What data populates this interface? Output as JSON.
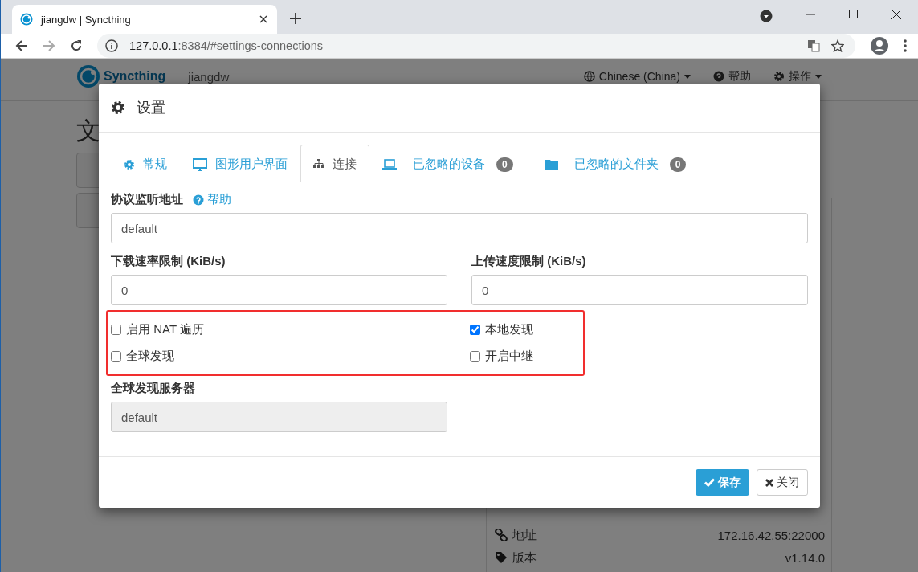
{
  "browser": {
    "tab_title": "jiangdw | Syncthing",
    "url_host": "127.0.0.1",
    "url_rest": ":8384/#settings-connections"
  },
  "page": {
    "brand": "Syncthing",
    "device_name": "jiangdw",
    "nav": [
      {
        "kind": "language",
        "label": "Chinese (China)"
      },
      {
        "kind": "help",
        "label": "帮助"
      },
      {
        "kind": "actions",
        "label": "操作"
      }
    ],
    "heading": "文",
    "info_rows": [
      {
        "kind": "address",
        "label": "地址",
        "value": "172.16.42.55:22000"
      },
      {
        "kind": "version",
        "label": "版本",
        "value": "v1.14.0"
      }
    ]
  },
  "dialog": {
    "title": "设置",
    "tabs": [
      {
        "label": "常规",
        "selected": false
      },
      {
        "label": "图形用户界面",
        "selected": false
      },
      {
        "label": "连接",
        "selected": true
      },
      {
        "label": "已忽略的设备",
        "count": "0",
        "selected": false
      },
      {
        "label": "已忽略的文件夹",
        "count": "0",
        "selected": false
      }
    ],
    "listen_address": {
      "label": "协议监听地址",
      "help": "帮助",
      "value": "default"
    },
    "download_limit": {
      "label": "下载速率限制 (KiB/s)",
      "value": "0"
    },
    "upload_limit": {
      "label": "上传速度限制 (KiB/s)",
      "value": "0"
    },
    "options": [
      {
        "label": "启用 NAT 遍历",
        "checked": false
      },
      {
        "label": "本地发现",
        "checked": true
      },
      {
        "label": "全球发现",
        "checked": false
      },
      {
        "label": "开启中继",
        "checked": false
      }
    ],
    "discovery_servers": {
      "label": "全球发现服务器",
      "value": "default",
      "disabled": true
    },
    "buttons": [
      {
        "kind": "primary",
        "label": "保存"
      },
      {
        "kind": "default",
        "label": "关闭"
      }
    ]
  }
}
